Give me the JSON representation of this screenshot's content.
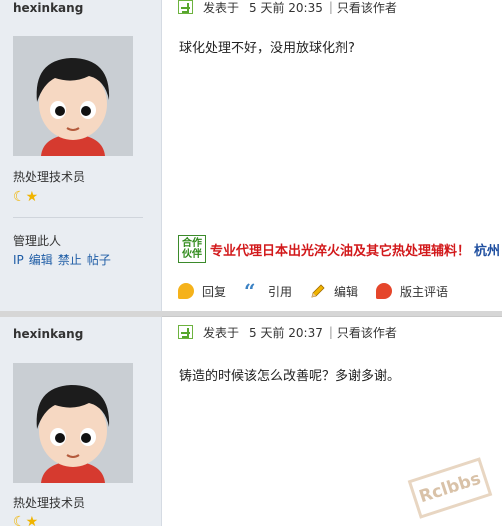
{
  "posts": [
    {
      "username": "hexinkang",
      "rank": "热处理技术员",
      "manage_label": "管理此人",
      "admin_links": [
        "IP",
        "编辑",
        "禁止",
        "帖子"
      ],
      "header": {
        "posted_label": "发表于",
        "time": "5 天前 20:35",
        "separator": "|",
        "only_author": "只看该作者"
      },
      "content": "球化处理不好，没用放球化剂?",
      "partner_badge": [
        "合作",
        "伙伴"
      ],
      "ad_text": "专业代理日本出光淬火油及其它热处理辅料！",
      "ad_text2": "杭州",
      "actions": [
        "回复",
        "引用",
        "编辑",
        "版主评语"
      ]
    },
    {
      "username": "hexinkang",
      "rank": "热处理技术员",
      "header": {
        "posted_label": "发表于",
        "time": "5 天前 20:37",
        "separator": "|",
        "only_author": "只看该作者"
      },
      "content": "铸造的时候该怎么改善呢？多谢多谢。"
    }
  ],
  "watermark": "Rclbbs",
  "icons": {
    "post-icon": "green-check-page",
    "reply-icon": "orange-speech-bubble",
    "quote-icon": "blue-quote-marks",
    "edit-icon": "pencil",
    "mod-comment-icon": "red-speech-bubble",
    "moon-icon": "crescent-moon",
    "star-icon": "star"
  },
  "colors": {
    "sidebar_bg": "#e9edf2",
    "link": "#1f5da6",
    "ad_red": "#d2191b",
    "ad_blue": "#1f4fa0",
    "partner_green": "#2f8a1a"
  }
}
